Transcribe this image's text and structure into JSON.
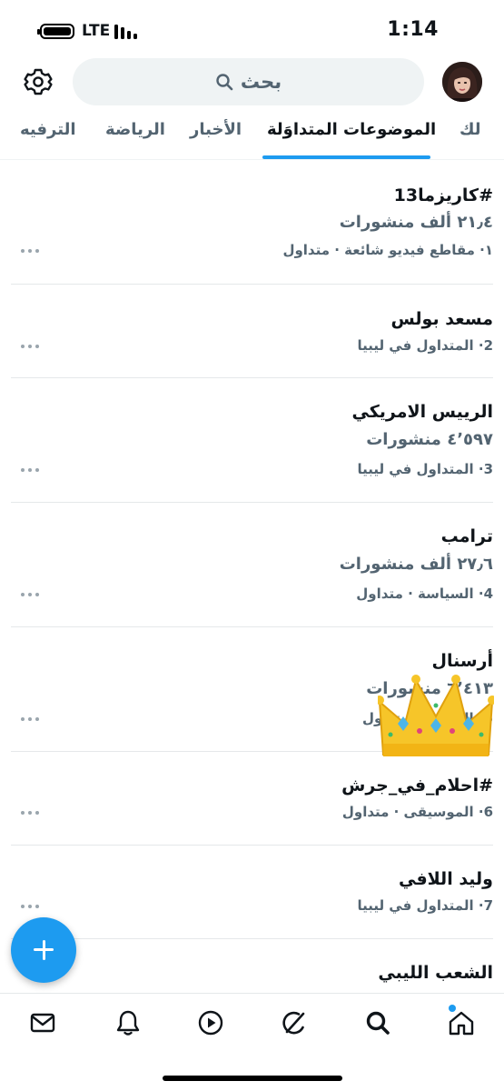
{
  "status_bar": {
    "time": "1:14",
    "network": "LTE"
  },
  "header": {
    "search_placeholder": "بحث"
  },
  "tabs": [
    {
      "label": "لك"
    },
    {
      "label": "الموضوعات المتداوَلة"
    },
    {
      "label": "الأخبار"
    },
    {
      "label": "الرياضة"
    },
    {
      "label": "الترفيه"
    }
  ],
  "active_tab": "الموضوعات المتداوَلة",
  "trends": [
    {
      "name": "#كاريزما13",
      "count": "٢١٫٤ ألف منشورات",
      "meta": "١· مقاطع فيديو شائعة · متداول"
    },
    {
      "name": "مسعد بولس",
      "meta": "2· المتداول في ليبيا"
    },
    {
      "name": "الرييس الامريكي",
      "count": "٤٬٥٩٧ منشورات",
      "meta": "3· المتداول في ليبيا"
    },
    {
      "name": "ترامب",
      "count": "٢٧٫٦ ألف منشورات",
      "meta": "4· السياسة · متداول"
    },
    {
      "name": "أرسنال",
      "count": "٦٬٤١٣ منشورات",
      "meta": "5· الرياضة · متداول"
    },
    {
      "name": "#احلام_في_جرش",
      "meta": "6· الموسيقى · متداول"
    },
    {
      "name": "وليد اللافي",
      "meta": "7· المتداول في ليبيا"
    },
    {
      "name": "الشعب الليبي"
    }
  ],
  "colors": {
    "accent": "#1d9bf0",
    "text_primary": "#0f1419",
    "text_secondary": "#536471"
  },
  "icons": {
    "settings": "gear-icon",
    "search": "search-icon",
    "more": "more-icon",
    "compose": "plus-icon",
    "messages": "mail-icon",
    "notifications": "bell-icon",
    "video": "play-icon",
    "grok": "grok-icon",
    "explore": "search-icon",
    "home": "home-icon",
    "sticker": "crown-icon"
  }
}
